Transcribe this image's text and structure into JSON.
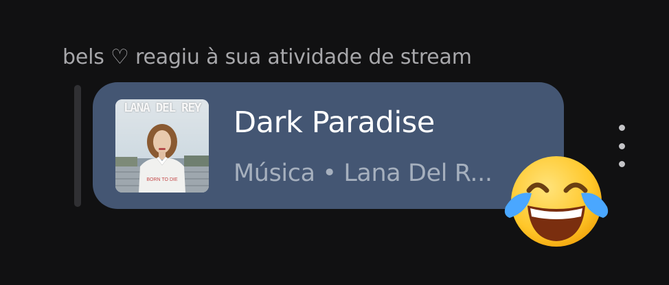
{
  "notification": {
    "text": "bels ♡ reagiu à sua atividade de stream"
  },
  "card": {
    "album_cover_text_top": "LANA DEL REY",
    "album_cover_text_bottom": "BORN TO DIE",
    "title": "Dark Paradise",
    "meta": "Música • Lana Del R...",
    "accent_color": "#445673"
  },
  "reaction": {
    "emoji_name": "face-with-tears-of-joy"
  },
  "menu": {
    "icon": "vertical-dots-icon"
  }
}
